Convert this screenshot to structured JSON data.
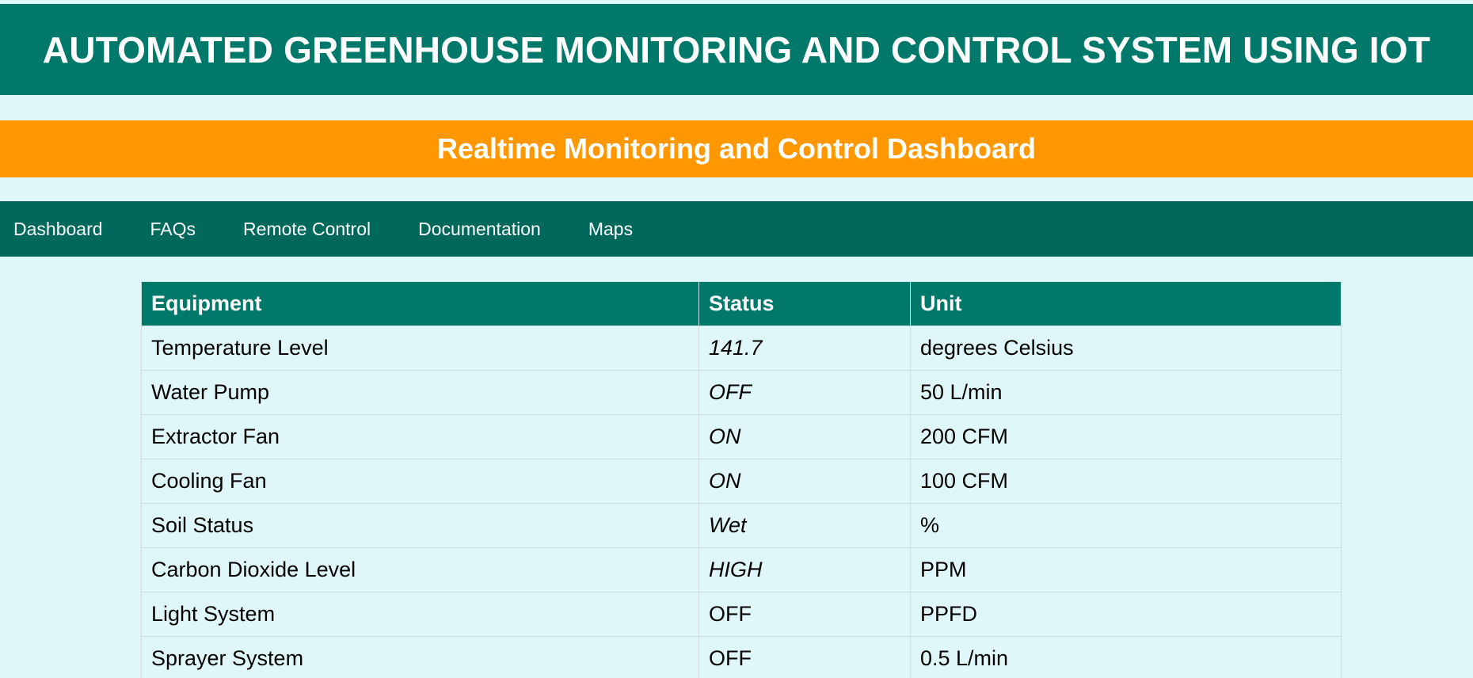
{
  "header": {
    "title": "AUTOMATED GREENHOUSE MONITORING AND CONTROL SYSTEM USING IOT",
    "subtitle": "Realtime Monitoring and Control Dashboard",
    "colors": {
      "primary": "#00796b",
      "nav": "#00695c",
      "accent": "#ff9800",
      "background": "#e0f7fa"
    }
  },
  "nav": {
    "items": [
      {
        "label": "Dashboard"
      },
      {
        "label": "FAQs"
      },
      {
        "label": "Remote Control"
      },
      {
        "label": "Documentation"
      },
      {
        "label": "Maps"
      }
    ]
  },
  "table": {
    "columns": [
      "Equipment",
      "Status",
      "Unit"
    ],
    "rows": [
      {
        "equipment": "Temperature Level",
        "status": "141.7",
        "unit": "degrees Celsius",
        "italic": true
      },
      {
        "equipment": "Water Pump",
        "status": "OFF",
        "unit": "50 L/min",
        "italic": true
      },
      {
        "equipment": "Extractor Fan",
        "status": "ON",
        "unit": "200 CFM",
        "italic": true
      },
      {
        "equipment": "Cooling Fan",
        "status": "ON",
        "unit": "100 CFM",
        "italic": true
      },
      {
        "equipment": "Soil Status",
        "status": "Wet",
        "unit": "%",
        "italic": true
      },
      {
        "equipment": "Carbon Dioxide Level",
        "status": "HIGH",
        "unit": "PPM",
        "italic": true
      },
      {
        "equipment": "Light System",
        "status": "OFF",
        "unit": "PPFD",
        "italic": false
      },
      {
        "equipment": "Sprayer System",
        "status": "OFF",
        "unit": "0.5 L/min",
        "italic": false
      }
    ]
  }
}
